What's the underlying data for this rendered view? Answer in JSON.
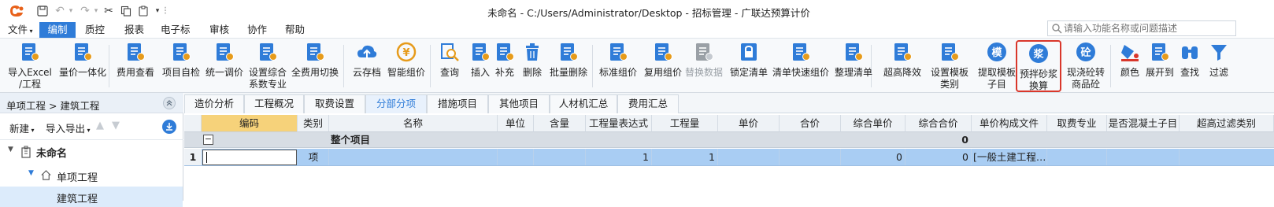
{
  "window": {
    "title": "未命名 - C:/Users/Administrator/Desktop - 招标管理 - 广联达预算计价"
  },
  "menu": {
    "items": [
      "文件",
      "编制",
      "质控",
      "报表",
      "电子标",
      "审核",
      "协作",
      "帮助"
    ],
    "active": "编制",
    "search_placeholder": "请输入功能名称或问题描述"
  },
  "ribbon": {
    "buttons": [
      {
        "id": "import-excel",
        "label1": "导入Excel",
        "label2": "/工程",
        "icon": "excel-import-icon",
        "color": "#2f7cd8"
      },
      {
        "id": "price-integration",
        "label1": "量价一体化",
        "label2": "",
        "icon": "integration-icon",
        "color": "#2f7cd8"
      },
      {
        "id": "fee-view",
        "label1": "费用查看",
        "label2": "",
        "icon": "fee-view-icon",
        "color": "#2f7cd8"
      },
      {
        "id": "self-check",
        "label1": "项目自检",
        "label2": "",
        "icon": "self-check-icon",
        "color": "#2f7cd8"
      },
      {
        "id": "unified-price",
        "label1": "统一调价",
        "label2": "",
        "icon": "price-adjust-icon",
        "color": "#2f7cd8"
      },
      {
        "id": "set-composite",
        "label1": "设置综合",
        "label2": "系数专业",
        "icon": "percent-icon",
        "color": "#2f7cd8"
      },
      {
        "id": "full-switch",
        "label1": "全费用切换",
        "label2": "",
        "icon": "switch-icon",
        "color": "#2f7cd8"
      },
      {
        "id": "cloud-save",
        "label1": "云存档",
        "label2": "",
        "icon": "cloud-upload-icon",
        "color": "#2f7cd8"
      },
      {
        "id": "smart-price",
        "label1": "智能组价",
        "label2": "",
        "icon": "smart-price-icon",
        "color": "#e69b1b"
      },
      {
        "id": "query",
        "label1": "查询",
        "label2": "",
        "icon": "search-icon",
        "color": "#2f7cd8"
      },
      {
        "id": "insert",
        "label1": "插入",
        "label2": "",
        "icon": "insert-icon",
        "color": "#2f7cd8"
      },
      {
        "id": "supplement",
        "label1": "补充",
        "label2": "",
        "icon": "supplement-icon",
        "color": "#2f7cd8"
      },
      {
        "id": "delete",
        "label1": "删除",
        "label2": "",
        "icon": "trash-icon",
        "color": "#2f7cd8"
      },
      {
        "id": "batch-delete",
        "label1": "批量删除",
        "label2": "",
        "icon": "batch-delete-icon",
        "color": "#2f7cd8"
      },
      {
        "id": "standard-price",
        "label1": "标准组价",
        "label2": "",
        "icon": "standard-price-icon",
        "color": "#2f7cd8"
      },
      {
        "id": "reuse-price",
        "label1": "复用组价",
        "label2": "",
        "icon": "reuse-price-icon",
        "color": "#2f7cd8"
      },
      {
        "id": "replace-data",
        "label1": "替换数据",
        "label2": "",
        "icon": "replace-icon",
        "color": "#9aa0a6",
        "disabled": true
      },
      {
        "id": "lock-list",
        "label1": "锁定清单",
        "label2": "",
        "icon": "lock-icon",
        "color": "#2f7cd8"
      },
      {
        "id": "quick-price",
        "label1": "清单快速组价",
        "label2": "",
        "icon": "quick-price-icon",
        "color": "#2f7cd8"
      },
      {
        "id": "tidy-list",
        "label1": "整理清单",
        "label2": "",
        "icon": "tidy-icon",
        "color": "#2f7cd8"
      },
      {
        "id": "high-efficiency",
        "label1": "超高降效",
        "label2": "",
        "icon": "high-efficiency-icon",
        "color": "#2f7cd8"
      },
      {
        "id": "template-category",
        "label1": "设置模板",
        "label2": "类别",
        "icon": "template-set-icon",
        "color": "#2f7cd8"
      },
      {
        "id": "extract-template",
        "label1": "提取模板",
        "label2": "子目",
        "icon": "template-extract-icon",
        "color": "#2f7cd8",
        "glyph": "模"
      },
      {
        "id": "premix-mortar",
        "label1": "预拌砂浆",
        "label2": "换算",
        "icon": "mortar-icon",
        "color": "#2f7cd8",
        "glyph": "浆",
        "highlight": true
      },
      {
        "id": "cast-concrete",
        "label1": "现浇砼转",
        "label2": "商品砼",
        "icon": "concrete-icon",
        "color": "#2f7cd8",
        "glyph": "砼"
      },
      {
        "id": "color",
        "label1": "颜色",
        "label2": "",
        "icon": "paint-bucket-icon",
        "color": "#d9372b"
      },
      {
        "id": "expand-to",
        "label1": "展开到",
        "label2": "",
        "icon": "expand-tree-icon",
        "color": "#2f7cd8"
      },
      {
        "id": "find",
        "label1": "查找",
        "label2": "",
        "icon": "binoculars-icon",
        "color": "#2f7cd8"
      },
      {
        "id": "filter",
        "label1": "过滤",
        "label2": "",
        "icon": "filter-icon",
        "color": "#2f7cd8"
      }
    ]
  },
  "left_panel": {
    "breadcrumb": "单项工程 > 建筑工程",
    "tool_new": "新建",
    "tool_import_export": "导入导出",
    "tree": [
      {
        "label": "未命名",
        "level": 0,
        "icon": "building-icon"
      },
      {
        "label": "单项工程",
        "level": 1,
        "icon": "home-icon"
      },
      {
        "label": "建筑工程",
        "level": 2,
        "icon": "",
        "selected": true
      }
    ]
  },
  "tabs": {
    "items": [
      "造价分析",
      "工程概况",
      "取费设置",
      "分部分项",
      "措施项目",
      "其他项目",
      "人材机汇总",
      "费用汇总"
    ],
    "active": "分部分项"
  },
  "grid": {
    "columns": [
      "",
      "编码",
      "类别",
      "名称",
      "单位",
      "含量",
      "工程量表达式",
      "工程量",
      "单价",
      "合价",
      "综合单价",
      "综合合价",
      "单价构成文件",
      "取费专业",
      "是否混凝土子目",
      "超高过滤类别"
    ],
    "selected_column": "编码",
    "group_row": {
      "toggle": "−",
      "name": "整个项目",
      "total": "0"
    },
    "rows": [
      {
        "num": "1",
        "code": "",
        "type": "项",
        "name": "",
        "unit": "",
        "qty_content": "",
        "expr": "1",
        "qty": "1",
        "price": "",
        "total": "",
        "comp_price": "0",
        "comp_total": "0",
        "price_file": "[一般土建工程…",
        "fee_major": "",
        "is_concrete": "",
        "height_filter": ""
      }
    ]
  }
}
